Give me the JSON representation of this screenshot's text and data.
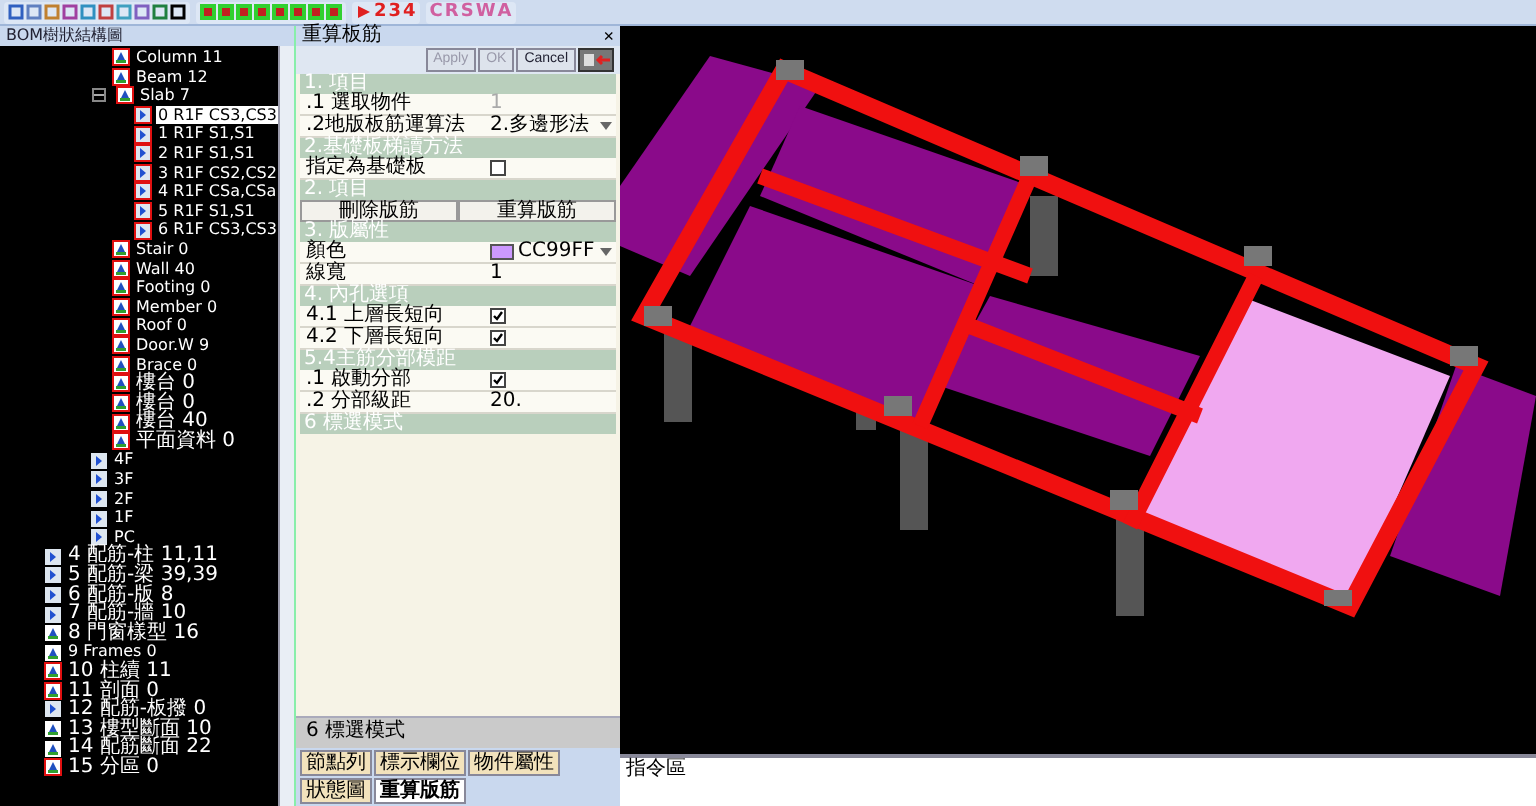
{
  "toolbar": {
    "numbers": [
      "2",
      "3",
      "4"
    ],
    "letters": [
      "C",
      "R",
      "S",
      "W",
      "A"
    ]
  },
  "tree_panel": {
    "title": "BOM樹狀結構圖",
    "branch": [
      {
        "label": "Column 11",
        "kind": "model",
        "marked": true
      },
      {
        "label": "Beam 12",
        "kind": "model",
        "marked": true
      },
      {
        "label": "Slab 7",
        "kind": "model",
        "marked": true,
        "expanded": true,
        "children": [
          {
            "label": "0 R1F CS3,CS3",
            "kind": "floor",
            "marked": true,
            "selected": true
          },
          {
            "label": "1 R1F S1,S1",
            "kind": "floor",
            "marked": true,
            "selected": false
          },
          {
            "label": "2 R1F S1,S1",
            "kind": "floor",
            "marked": true,
            "selected": false
          },
          {
            "label": "3 R1F CS2,CS2",
            "kind": "floor",
            "marked": true,
            "selected": false
          },
          {
            "label": "4 R1F CSa,CSa",
            "kind": "floor",
            "marked": true,
            "selected": false
          },
          {
            "label": "5 R1F S1,S1",
            "kind": "floor",
            "marked": true,
            "selected": false
          },
          {
            "label": "6 R1F CS3,CS3",
            "kind": "floor",
            "marked": true,
            "selected": false
          }
        ]
      },
      {
        "label": "Stair 0",
        "kind": "model",
        "marked": true
      },
      {
        "label": "Wall 40",
        "kind": "model",
        "marked": true
      },
      {
        "label": "Footing 0",
        "kind": "model",
        "marked": true
      },
      {
        "label": "Member 0",
        "kind": "model",
        "marked": true
      },
      {
        "label": "Roof 0",
        "kind": "model",
        "marked": true
      },
      {
        "label": "Door.W 9",
        "kind": "model",
        "marked": true
      },
      {
        "label": "Brace 0",
        "kind": "model",
        "marked": true
      },
      {
        "label": "樓台 0",
        "kind": "model",
        "marked": true
      },
      {
        "label": "樓台 0",
        "kind": "model",
        "marked": true
      },
      {
        "label": "樓台 40",
        "kind": "model",
        "marked": true
      },
      {
        "label": "平面資料 0",
        "kind": "model",
        "marked": true
      }
    ],
    "floors": [
      {
        "label": "4F",
        "kind": "floor",
        "marked": false
      },
      {
        "label": "3F",
        "kind": "floor",
        "marked": false
      },
      {
        "label": "2F",
        "kind": "floor",
        "marked": false
      },
      {
        "label": "1F",
        "kind": "floor",
        "marked": false
      },
      {
        "label": "PC",
        "kind": "floor",
        "marked": false
      }
    ],
    "items": [
      {
        "label": "4 配筋-柱 11,11",
        "kind": "floor",
        "marked": false
      },
      {
        "label": "5 配筋-梁 39,39",
        "kind": "floor",
        "marked": false
      },
      {
        "label": "6 配筋-版 8",
        "kind": "floor",
        "marked": false
      },
      {
        "label": "7 配筋-牆 10",
        "kind": "floor",
        "marked": false
      },
      {
        "label": "8 門窗樣型 16",
        "kind": "model",
        "marked": false
      },
      {
        "label": "9 Frames 0",
        "kind": "model",
        "marked": false
      },
      {
        "label": "10 柱續 11",
        "kind": "model",
        "marked": true
      },
      {
        "label": "11 剖面 0",
        "kind": "model",
        "marked": true
      },
      {
        "label": "12 配筋-板撥 0",
        "kind": "floor",
        "marked": false
      },
      {
        "label": "13 樓型斷面 10",
        "kind": "model",
        "marked": false
      },
      {
        "label": "14 配筋斷面 22",
        "kind": "model",
        "marked": false
      },
      {
        "label": "15 分區 0",
        "kind": "model",
        "marked": true
      }
    ]
  },
  "property_panel": {
    "title": "重算板筋",
    "close": "×",
    "buttons": [
      {
        "label": "Apply",
        "disabled": true
      },
      {
        "label": "OK",
        "disabled": true
      },
      {
        "label": "Cancel",
        "disabled": false
      }
    ],
    "sections": [
      {
        "title": "1. 項目",
        "rows": [
          {
            "kind": "text",
            "label": ".1 選取物件",
            "value": "1",
            "disabled": true
          },
          {
            "kind": "dropdown",
            "label": ".2地版板筋運算法",
            "value": "2.多邊形法",
            "disabled": false
          }
        ]
      },
      {
        "title": "2.基礎板梯讀方法",
        "rows": [
          {
            "kind": "checkbox",
            "label": "指定為基礎板",
            "checked": false
          }
        ]
      },
      {
        "title": "2. 項目",
        "rows": [
          {
            "kind": "buttons",
            "labels": [
              "刪除版筋",
              "重算版筋"
            ]
          }
        ]
      },
      {
        "title": "3. 版屬性",
        "rows": [
          {
            "kind": "color",
            "label": "顏色",
            "value": "CC99FF",
            "color": "#cc99ff"
          },
          {
            "kind": "text",
            "label": "線寬",
            "value": "1",
            "disabled": false
          }
        ]
      },
      {
        "title": "4. 內孔選項",
        "rows": [
          {
            "kind": "checkbox",
            "label": "4.1 上層長短向",
            "checked": true
          },
          {
            "kind": "checkbox",
            "label": "4.2 下層長短向",
            "checked": true
          }
        ]
      },
      {
        "title": "5.4主筋分部模距",
        "rows": [
          {
            "kind": "checkbox",
            "label": ".1 啟動分部",
            "checked": true
          },
          {
            "kind": "text",
            "label": ".2 分部級距",
            "value": "20.",
            "disabled": false
          }
        ]
      },
      {
        "title": "6 標選模式"
      }
    ],
    "description": "6 標選模式",
    "tabs": [
      {
        "label": "節點列",
        "selected": false
      },
      {
        "label": "標示欄位",
        "selected": false
      },
      {
        "label": "物件屬性",
        "selected": false
      },
      {
        "label": "狀態圖",
        "selected": false
      },
      {
        "label": "重算版筋",
        "selected": true
      }
    ]
  },
  "command_area": {
    "title": "指令區"
  }
}
